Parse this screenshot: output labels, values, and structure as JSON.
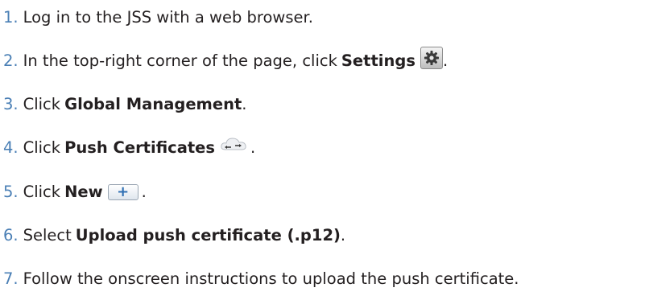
{
  "steps": [
    {
      "num": "1.",
      "text": "Log in to the JSS with a web browser."
    },
    {
      "num": "2.",
      "pre": "In the top-right corner of the page, click",
      "bold": "Settings",
      "post": "."
    },
    {
      "num": "3.",
      "pre": "Click",
      "bold": "Global Management",
      "post": "."
    },
    {
      "num": "4.",
      "pre": "Click",
      "bold": "Push Certificates",
      "post": "."
    },
    {
      "num": "5.",
      "pre": "Click",
      "bold": "New",
      "post": "."
    },
    {
      "num": "6.",
      "pre": "Select",
      "bold": "Upload push certificate (.p12)",
      "post": "."
    },
    {
      "num": "7.",
      "text": "Follow the onscreen instructions to upload the push certificate."
    }
  ],
  "icons": {
    "settings": "gear-icon",
    "push_certificates": "cloud-sync-icon",
    "new": "plus-icon",
    "new_glyph": "+"
  },
  "colors": {
    "step_number": "#4a7fb5",
    "text": "#231f20"
  }
}
